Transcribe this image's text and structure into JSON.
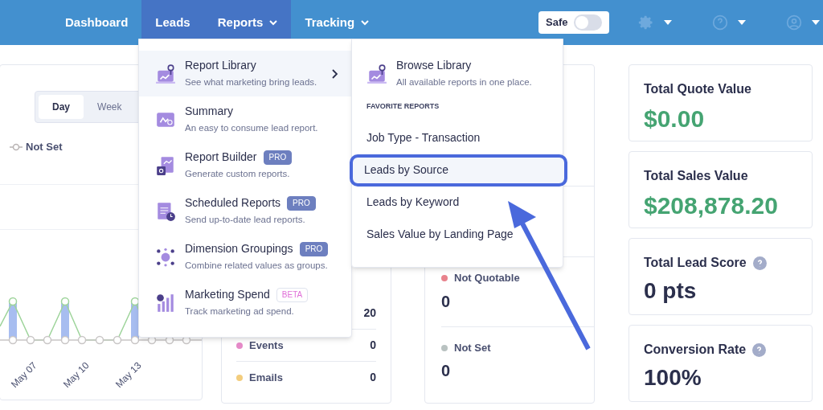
{
  "nav": {
    "items": [
      {
        "label": "Dashboard",
        "selected": false,
        "dropdown": false
      },
      {
        "label": "Leads",
        "selected": true,
        "dropdown": false
      },
      {
        "label": "Reports",
        "selected": true,
        "dropdown": true
      },
      {
        "label": "Tracking",
        "selected": false,
        "dropdown": true
      }
    ],
    "safe_toggle": {
      "label": "Safe",
      "on": false
    }
  },
  "chart_card": {
    "periods": [
      {
        "label": "Day",
        "selected": true
      },
      {
        "label": "Week",
        "selected": false
      }
    ],
    "legend": "Not Set",
    "x_labels": [
      "May 07",
      "May 10",
      "May 13"
    ]
  },
  "sources_card": {
    "rows": [
      {
        "value": "20"
      },
      {
        "label": "Events",
        "value": "0",
        "color": "#e58ac8"
      },
      {
        "label": "Emails",
        "value": "0",
        "color": "#f3cd7d"
      }
    ]
  },
  "status_card": {
    "rows": [
      {
        "label": "Not Quotable",
        "value": "0",
        "color": "#e8828c"
      },
      {
        "label": "Not Set",
        "value": "0",
        "color": "#b9c2c1"
      }
    ]
  },
  "stats": [
    {
      "title": "Total Quote Value",
      "value": "$0.00",
      "kind": "money",
      "help": false
    },
    {
      "title": "Total Sales Value",
      "value": "$208,878.20",
      "kind": "money",
      "help": false
    },
    {
      "title": "Total Lead Score",
      "value": "0 pts",
      "kind": "plain",
      "help": true
    },
    {
      "title": "Conversion Rate",
      "value": "100%",
      "kind": "plain",
      "help": true
    }
  ],
  "reports_menu": {
    "items": [
      {
        "title": "Report Library",
        "description": "See what marketing bring leads.",
        "selected": true,
        "submenu": true
      },
      {
        "title": "Summary",
        "description": "An easy to consume lead report.",
        "selected": false,
        "submenu": false
      },
      {
        "title": "Report Builder",
        "description": "Generate custom reports.",
        "selected": false,
        "submenu": false,
        "badge": "PRO",
        "kind": "pro"
      },
      {
        "title": "Scheduled Reports",
        "description": "Send up-to-date lead reports.",
        "selected": false,
        "submenu": false,
        "badge": "PRO",
        "kind": "pro"
      },
      {
        "title": "Dimension Groupings",
        "description": "Combine related values as groups.",
        "selected": false,
        "submenu": false,
        "badge": "PRO",
        "kind": "pro"
      },
      {
        "title": "Marketing Spend",
        "description": "Track marketing ad spend.",
        "selected": false,
        "submenu": false,
        "badge": "BETA",
        "kind": "beta"
      }
    ]
  },
  "library_submenu": {
    "browse": {
      "title": "Browse Library",
      "description": "All available reports in one place."
    },
    "section": "FAVORITE REPORTS",
    "favorites": [
      {
        "label": "Job Type - Transaction",
        "highlighted": false
      },
      {
        "label": "Leads by Source",
        "highlighted": true
      },
      {
        "label": "Leads by Keyword",
        "highlighted": false
      },
      {
        "label": "Sales Value by Landing Page",
        "highlighted": false
      }
    ]
  }
}
